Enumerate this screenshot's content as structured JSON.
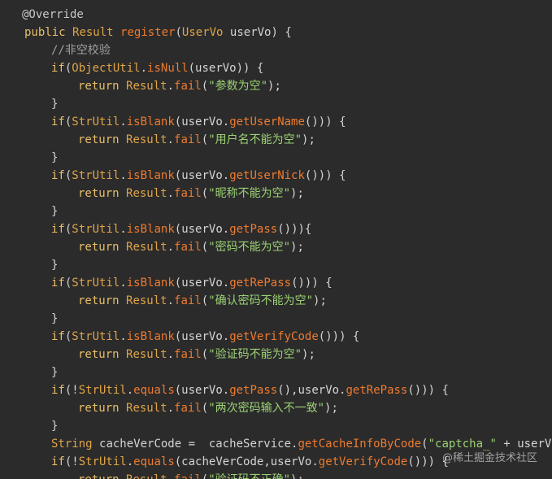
{
  "colors": {
    "background": "#2b2b2b",
    "plain": "#d4d4d4",
    "keyword": "#e8bf6a",
    "type": "#e0a547",
    "method": "#ee7b30",
    "string": "#9bd174",
    "comment": "#a0a0a0",
    "annotation": "#c8c8c8"
  },
  "code_lines": [
    {
      "indent": 0,
      "tokens": [
        {
          "text": "@Override",
          "kind": "annotation"
        }
      ]
    },
    {
      "indent": 1,
      "tokens": [
        {
          "text": "public ",
          "kind": "keyword"
        },
        {
          "text": "Result ",
          "kind": "type"
        },
        {
          "text": "register",
          "kind": "method"
        },
        {
          "text": "(",
          "kind": "plain"
        },
        {
          "text": "UserVo",
          "kind": "type"
        },
        {
          "text": " userVo) {",
          "kind": "plain"
        }
      ]
    },
    {
      "indent": 2,
      "tokens": [
        {
          "text": "//非空校验",
          "kind": "comment"
        }
      ]
    },
    {
      "indent": 2,
      "tokens": [
        {
          "text": "if",
          "kind": "keyword"
        },
        {
          "text": "(",
          "kind": "plain"
        },
        {
          "text": "ObjectUtil",
          "kind": "type"
        },
        {
          "text": ".",
          "kind": "plain"
        },
        {
          "text": "isNull",
          "kind": "method"
        },
        {
          "text": "(userVo)) {",
          "kind": "plain"
        }
      ]
    },
    {
      "indent": 3,
      "tokens": [
        {
          "text": "return ",
          "kind": "keyword"
        },
        {
          "text": "Result",
          "kind": "type"
        },
        {
          "text": ".",
          "kind": "plain"
        },
        {
          "text": "fail",
          "kind": "method"
        },
        {
          "text": "(",
          "kind": "plain"
        },
        {
          "text": "\"参数为空\"",
          "kind": "string"
        },
        {
          "text": ");",
          "kind": "plain"
        }
      ]
    },
    {
      "indent": 2,
      "tokens": [
        {
          "text": "}",
          "kind": "plain"
        }
      ]
    },
    {
      "indent": 2,
      "tokens": [
        {
          "text": "if",
          "kind": "keyword"
        },
        {
          "text": "(",
          "kind": "plain"
        },
        {
          "text": "StrUtil",
          "kind": "type"
        },
        {
          "text": ".",
          "kind": "plain"
        },
        {
          "text": "isBlank",
          "kind": "method"
        },
        {
          "text": "(userVo.",
          "kind": "plain"
        },
        {
          "text": "getUserName",
          "kind": "method"
        },
        {
          "text": "())) {",
          "kind": "plain"
        }
      ]
    },
    {
      "indent": 3,
      "tokens": [
        {
          "text": "return ",
          "kind": "keyword"
        },
        {
          "text": "Result",
          "kind": "type"
        },
        {
          "text": ".",
          "kind": "plain"
        },
        {
          "text": "fail",
          "kind": "method"
        },
        {
          "text": "(",
          "kind": "plain"
        },
        {
          "text": "\"用户名不能为空\"",
          "kind": "string"
        },
        {
          "text": ");",
          "kind": "plain"
        }
      ]
    },
    {
      "indent": 2,
      "tokens": [
        {
          "text": "}",
          "kind": "plain"
        }
      ]
    },
    {
      "indent": 2,
      "tokens": [
        {
          "text": "if",
          "kind": "keyword"
        },
        {
          "text": "(",
          "kind": "plain"
        },
        {
          "text": "StrUtil",
          "kind": "type"
        },
        {
          "text": ".",
          "kind": "plain"
        },
        {
          "text": "isBlank",
          "kind": "method"
        },
        {
          "text": "(userVo.",
          "kind": "plain"
        },
        {
          "text": "getUserNick",
          "kind": "method"
        },
        {
          "text": "())) {",
          "kind": "plain"
        }
      ]
    },
    {
      "indent": 3,
      "tokens": [
        {
          "text": "return ",
          "kind": "keyword"
        },
        {
          "text": "Result",
          "kind": "type"
        },
        {
          "text": ".",
          "kind": "plain"
        },
        {
          "text": "fail",
          "kind": "method"
        },
        {
          "text": "(",
          "kind": "plain"
        },
        {
          "text": "\"昵称不能为空\"",
          "kind": "string"
        },
        {
          "text": ");",
          "kind": "plain"
        }
      ]
    },
    {
      "indent": 2,
      "tokens": [
        {
          "text": "}",
          "kind": "plain"
        }
      ]
    },
    {
      "indent": 2,
      "tokens": [
        {
          "text": "if",
          "kind": "keyword"
        },
        {
          "text": "(",
          "kind": "plain"
        },
        {
          "text": "StrUtil",
          "kind": "type"
        },
        {
          "text": ".",
          "kind": "plain"
        },
        {
          "text": "isBlank",
          "kind": "method"
        },
        {
          "text": "(userVo.",
          "kind": "plain"
        },
        {
          "text": "getPass",
          "kind": "method"
        },
        {
          "text": "())){",
          "kind": "plain"
        }
      ]
    },
    {
      "indent": 3,
      "tokens": [
        {
          "text": "return ",
          "kind": "keyword"
        },
        {
          "text": "Result",
          "kind": "type"
        },
        {
          "text": ".",
          "kind": "plain"
        },
        {
          "text": "fail",
          "kind": "method"
        },
        {
          "text": "(",
          "kind": "plain"
        },
        {
          "text": "\"密码不能为空\"",
          "kind": "string"
        },
        {
          "text": ");",
          "kind": "plain"
        }
      ]
    },
    {
      "indent": 2,
      "tokens": [
        {
          "text": "}",
          "kind": "plain"
        }
      ]
    },
    {
      "indent": 2,
      "tokens": [
        {
          "text": "if",
          "kind": "keyword"
        },
        {
          "text": "(",
          "kind": "plain"
        },
        {
          "text": "StrUtil",
          "kind": "type"
        },
        {
          "text": ".",
          "kind": "plain"
        },
        {
          "text": "isBlank",
          "kind": "method"
        },
        {
          "text": "(userVo.",
          "kind": "plain"
        },
        {
          "text": "getRePass",
          "kind": "method"
        },
        {
          "text": "())) {",
          "kind": "plain"
        }
      ]
    },
    {
      "indent": 3,
      "tokens": [
        {
          "text": "return ",
          "kind": "keyword"
        },
        {
          "text": "Result",
          "kind": "type"
        },
        {
          "text": ".",
          "kind": "plain"
        },
        {
          "text": "fail",
          "kind": "method"
        },
        {
          "text": "(",
          "kind": "plain"
        },
        {
          "text": "\"确认密码不能为空\"",
          "kind": "string"
        },
        {
          "text": ");",
          "kind": "plain"
        }
      ]
    },
    {
      "indent": 2,
      "tokens": [
        {
          "text": "}",
          "kind": "plain"
        }
      ]
    },
    {
      "indent": 2,
      "tokens": [
        {
          "text": "if",
          "kind": "keyword"
        },
        {
          "text": "(",
          "kind": "plain"
        },
        {
          "text": "StrUtil",
          "kind": "type"
        },
        {
          "text": ".",
          "kind": "plain"
        },
        {
          "text": "isBlank",
          "kind": "method"
        },
        {
          "text": "(userVo.",
          "kind": "plain"
        },
        {
          "text": "getVerifyCode",
          "kind": "method"
        },
        {
          "text": "())) {",
          "kind": "plain"
        }
      ]
    },
    {
      "indent": 3,
      "tokens": [
        {
          "text": "return ",
          "kind": "keyword"
        },
        {
          "text": "Result",
          "kind": "type"
        },
        {
          "text": ".",
          "kind": "plain"
        },
        {
          "text": "fail",
          "kind": "method"
        },
        {
          "text": "(",
          "kind": "plain"
        },
        {
          "text": "\"验证码不能为空\"",
          "kind": "string"
        },
        {
          "text": ");",
          "kind": "plain"
        }
      ]
    },
    {
      "indent": 2,
      "tokens": [
        {
          "text": "}",
          "kind": "plain"
        }
      ]
    },
    {
      "indent": 2,
      "tokens": [
        {
          "text": "if",
          "kind": "keyword"
        },
        {
          "text": "(!",
          "kind": "plain"
        },
        {
          "text": "StrUtil",
          "kind": "type"
        },
        {
          "text": ".",
          "kind": "plain"
        },
        {
          "text": "equals",
          "kind": "method"
        },
        {
          "text": "(userVo.",
          "kind": "plain"
        },
        {
          "text": "getPass",
          "kind": "method"
        },
        {
          "text": "(),userVo.",
          "kind": "plain"
        },
        {
          "text": "getRePass",
          "kind": "method"
        },
        {
          "text": "())) {",
          "kind": "plain"
        }
      ]
    },
    {
      "indent": 3,
      "tokens": [
        {
          "text": "return ",
          "kind": "keyword"
        },
        {
          "text": "Result",
          "kind": "type"
        },
        {
          "text": ".",
          "kind": "plain"
        },
        {
          "text": "fail",
          "kind": "method"
        },
        {
          "text": "(",
          "kind": "plain"
        },
        {
          "text": "\"两次密码输入不一致\"",
          "kind": "string"
        },
        {
          "text": ");",
          "kind": "plain"
        }
      ]
    },
    {
      "indent": 2,
      "tokens": [
        {
          "text": "}",
          "kind": "plain"
        }
      ]
    },
    {
      "indent": 2,
      "tokens": [
        {
          "text": "String ",
          "kind": "type"
        },
        {
          "text": "cacheVerCode =  cacheService.",
          "kind": "plain"
        },
        {
          "text": "getCacheInfoByCode",
          "kind": "method"
        },
        {
          "text": "(",
          "kind": "plain"
        },
        {
          "text": "\"captcha_\"",
          "kind": "string"
        },
        {
          "text": " + userVo.",
          "kind": "plain"
        }
      ]
    },
    {
      "indent": 2,
      "tokens": [
        {
          "text": "if",
          "kind": "keyword"
        },
        {
          "text": "(!",
          "kind": "plain"
        },
        {
          "text": "StrUtil",
          "kind": "type"
        },
        {
          "text": ".",
          "kind": "plain"
        },
        {
          "text": "equals",
          "kind": "method"
        },
        {
          "text": "(cacheVerCode,userVo.",
          "kind": "plain"
        },
        {
          "text": "getVerifyCode",
          "kind": "method"
        },
        {
          "text": "())) {",
          "kind": "plain"
        }
      ]
    },
    {
      "indent": 3,
      "tokens": [
        {
          "text": "return ",
          "kind": "keyword"
        },
        {
          "text": "Result",
          "kind": "type"
        },
        {
          "text": ".",
          "kind": "plain"
        },
        {
          "text": "fail",
          "kind": "method"
        },
        {
          "text": "(",
          "kind": "plain"
        },
        {
          "text": "\"验证码不正确\"",
          "kind": "string"
        },
        {
          "text": ");",
          "kind": "plain"
        }
      ]
    }
  ],
  "watermark": "@稀土掘金技术社区"
}
